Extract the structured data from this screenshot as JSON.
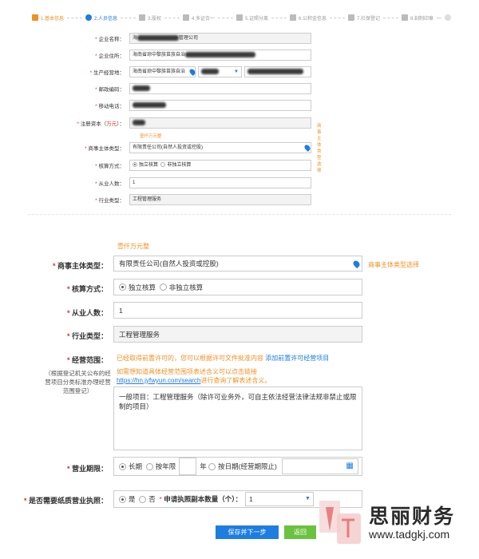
{
  "steps": [
    {
      "label": "1.基本信息",
      "icon": "bar-chart-icon",
      "state": "done"
    },
    {
      "label": "2.人员信息",
      "icon": "user-icon",
      "state": "current"
    },
    {
      "label": "3.股权",
      "icon": "document-icon",
      "state": "todo"
    },
    {
      "label": "4.多证合一",
      "icon": "flag-icon",
      "state": "todo"
    },
    {
      "label": "5.证照分离",
      "icon": "id-card-icon",
      "state": "todo"
    },
    {
      "label": "6.公积金信息",
      "icon": "clipboard-icon",
      "state": "todo"
    },
    {
      "label": "7.社保登记",
      "icon": "book-icon",
      "state": "todo"
    },
    {
      "label": "8.刻制印章",
      "icon": "stamp-icon",
      "state": "todo"
    }
  ],
  "small_form": {
    "company_name": {
      "label": "企业名称：",
      "value_start": "海",
      "value_end": "管理公司"
    },
    "address": {
      "label": "企业住所：",
      "value": "海南省琼中黎族苗族自治"
    },
    "business_place": {
      "label": "生产经营地：",
      "value": "海南省琼中黎族苗族自治"
    },
    "postcode": {
      "label": "邮政编码："
    },
    "mobile": {
      "label": "移动电话："
    },
    "capital": {
      "label_prefix": "注册资本（",
      "label_unit": "万元",
      "label_suffix": "）：",
      "hint": "壹仟万元整"
    },
    "entity_type": {
      "label": "商事主体类型：",
      "value": "有限责任公司(自然人投资或控股)",
      "link": "商事主体类型选择"
    },
    "accounting": {
      "label": "核算方式：",
      "options": [
        "独立核算",
        "非独立核算"
      ]
    },
    "employees": {
      "label": "从业人数：",
      "value": "1"
    },
    "industry": {
      "label": "行业类型：",
      "value": "工程管理服务"
    }
  },
  "big_form": {
    "capital_hint": "壹仟万元整",
    "entity_type": {
      "label": "商事主体类型：",
      "value": "有限责任公司(自然人投资或控股)",
      "link": "商事主体类型选择"
    },
    "accounting": {
      "label": "核算方式：",
      "options": [
        "独立核算",
        "非独立核算"
      ]
    },
    "employees": {
      "label": "从业人数：",
      "value": "1"
    },
    "industry": {
      "label": "行业类型：",
      "value": "工程管理服务"
    },
    "scope": {
      "label": "经营范围：",
      "permit_text": "已经取得前置许可的，您可以根据许可文件批准内容",
      "permit_link": "添加前置许可经营项目",
      "help_text": "如需想知道具体经营范围项表述含义可以点击链接",
      "help_url": "https://hn.jyfwyun.com/search",
      "help_suffix": "进行查询了解表述含义。",
      "side_note": "（根据登记机关公布的经营项目分类标准办理经营范围登记）",
      "content": "一般项目：工程管理服务（除许可业务外，可自主依法经营法律法规非禁止或限制的项目）"
    },
    "term": {
      "label": "营业期限：",
      "options": [
        "长期",
        "按年限",
        "按日期(经营期限止)"
      ],
      "year_unit": "年"
    },
    "paper_license": {
      "label": "是否需要纸质营业执照：",
      "options": [
        "是",
        "否"
      ],
      "copies_label": "申请执照副本数量（个）：",
      "copies_value": "1"
    },
    "save_button": "保存并下一步",
    "back_button": "返回"
  },
  "watermark": {
    "text": "思丽财务",
    "url": "www.tadgkj.com"
  },
  "colors": {
    "accent_blue": "#1e7de0",
    "accent_orange": "#f29024",
    "required_red": "#e0322f",
    "button_green": "#6ac23f"
  }
}
